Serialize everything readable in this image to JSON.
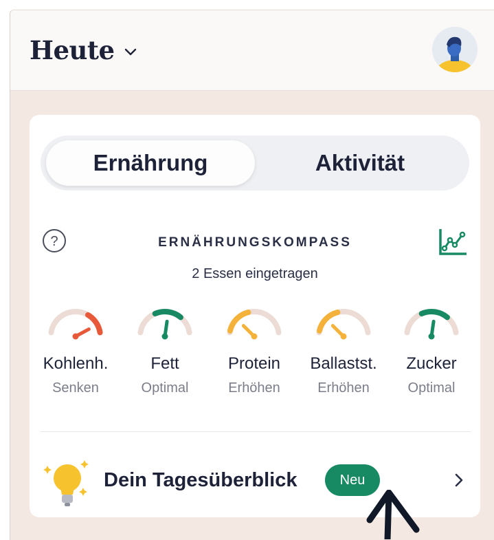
{
  "header": {
    "title": "Heute"
  },
  "tabs": {
    "active": "Ernährung",
    "inactive": "Aktivität"
  },
  "compass": {
    "title": "ERNÄHRUNGSKOMPASS",
    "subtitle": "2 Essen eingetragen"
  },
  "nutrients": [
    {
      "label": "Kohlenh.",
      "status": "Senken",
      "color": "#e8593a",
      "level": 0.88
    },
    {
      "label": "Fett",
      "status": "Optimal",
      "color": "#178a63",
      "level": 0.55
    },
    {
      "label": "Protein",
      "status": "Erhöhen",
      "color": "#f4b23a",
      "level": 0.22
    },
    {
      "label": "Ballastst.",
      "status": "Erhöhen",
      "color": "#f4b23a",
      "level": 0.22
    },
    {
      "label": "Zucker",
      "status": "Optimal",
      "color": "#178a63",
      "level": 0.55
    }
  ],
  "daily_overview": {
    "label": "Dein Tagesüberblick",
    "badge": "Neu"
  },
  "colors": {
    "accent": "#178a63",
    "text": "#1d2238",
    "background": "#f4e8e2"
  },
  "icons": [
    "chevron-down-icon",
    "avatar",
    "help-icon",
    "trend-chart-icon",
    "gauge-icon",
    "lightbulb-icon",
    "chevron-right-icon"
  ]
}
